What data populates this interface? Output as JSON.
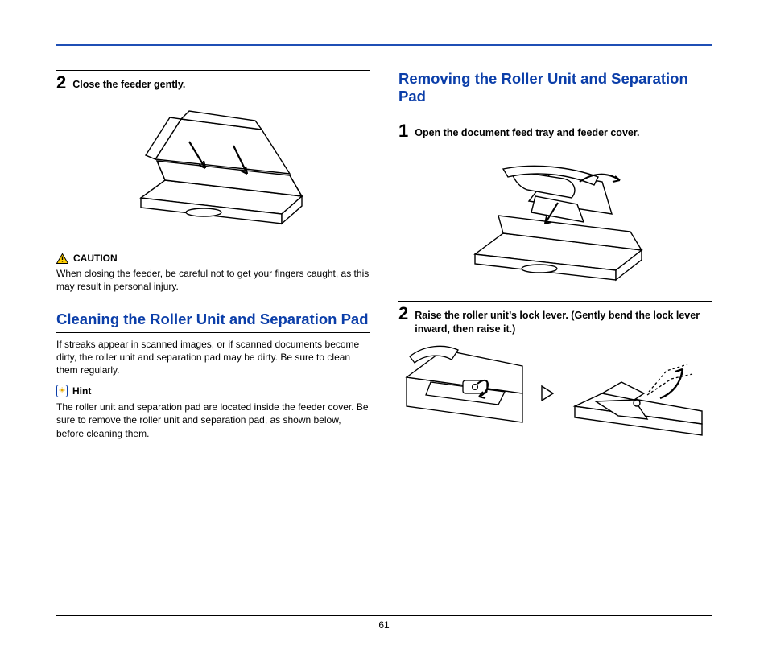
{
  "page_number": "61",
  "left": {
    "step2": {
      "num": "2",
      "text": "Close the feeder gently."
    },
    "caution_label": "CAUTION",
    "caution_text": "When closing the feeder, be careful not to get your fingers caught, as this may result in personal injury.",
    "heading": "Cleaning the Roller Unit and Separation Pad",
    "intro_text": "If streaks appear in scanned images, or if scanned documents become dirty, the roller unit and separation pad may be dirty. Be sure to clean them regularly.",
    "hint_label": "Hint",
    "hint_text": "The roller unit and separation pad are located inside the feeder cover. Be sure to remove the roller unit and separation pad, as shown below, before cleaning them."
  },
  "right": {
    "heading": "Removing the Roller Unit and Separation Pad",
    "step1": {
      "num": "1",
      "text": "Open the document feed tray and feeder cover."
    },
    "step2": {
      "num": "2",
      "text": "Raise the roller unit’s lock lever. (Gently bend the lock lever inward, then raise it.)"
    }
  }
}
